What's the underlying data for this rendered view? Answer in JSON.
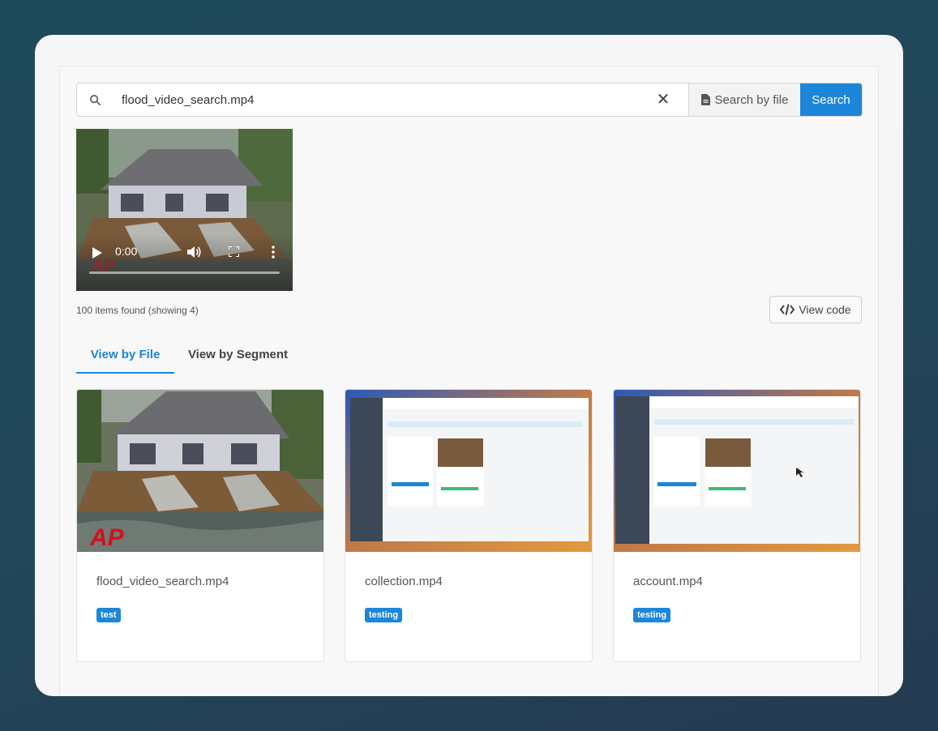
{
  "search": {
    "value": "flood_video_search.mp4",
    "clear_icon": "close-icon",
    "search_by_file_label": "Search by file",
    "search_label": "Search"
  },
  "player": {
    "time": "0:00",
    "watermark": "AP"
  },
  "results": {
    "count_text": "100 items found (showing 4)",
    "view_code_label": "View code"
  },
  "tabs": [
    {
      "label": "View by File",
      "active": true
    },
    {
      "label": "View by Segment",
      "active": false
    }
  ],
  "cards": [
    {
      "title": "flood_video_search.mp4",
      "tag": "test"
    },
    {
      "title": "collection.mp4",
      "tag": "testing"
    },
    {
      "title": "account.mp4",
      "tag": "testing"
    }
  ],
  "colors": {
    "accent": "#1c86d8",
    "tag": "#1c86d8"
  }
}
